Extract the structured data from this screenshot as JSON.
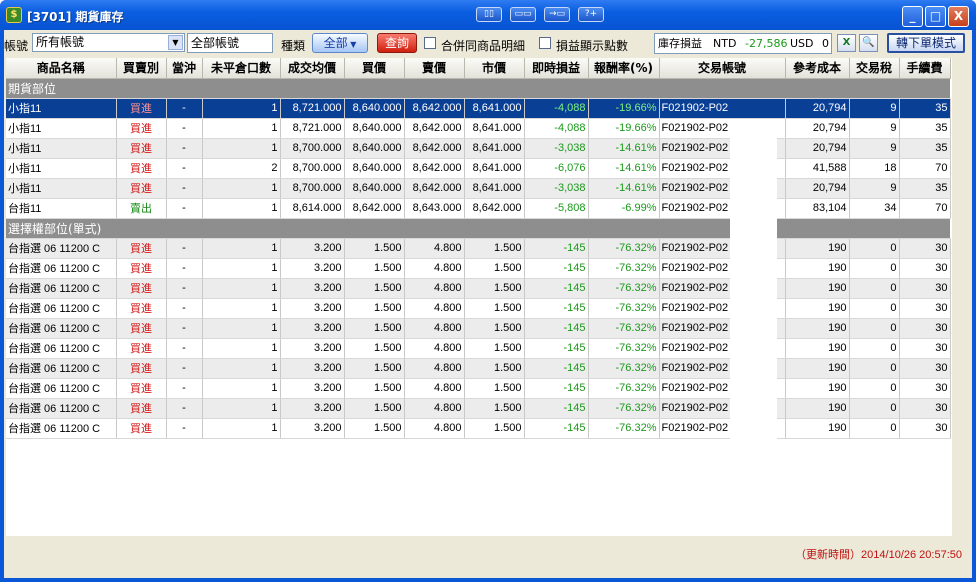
{
  "window": {
    "title": "[3701] 期貨庫存",
    "title_icon": "app-icon",
    "mid_buttons": [
      "▯▯",
      "▭▭",
      "→▭",
      "?+"
    ],
    "minimize": "_",
    "maximize": "□",
    "close": "X"
  },
  "toolbar": {
    "account_label": "帳號",
    "account_select": "所有帳號",
    "account_name": "全部帳號",
    "kind_label": "種類",
    "kind_button": "全部",
    "query_button": "查詢",
    "merge_label": "合併同商品明細",
    "points_label": "損益顯示點數",
    "pnl": {
      "label": "庫存損益",
      "ntd_label": "NTD",
      "ntd_value": "-27,586",
      "usd_label": "USD",
      "usd_value": "0"
    },
    "switch_button": "轉下單模式"
  },
  "columns": [
    "商品名稱",
    "買賣別",
    "當沖",
    "未平倉口數",
    "成交均價",
    "買價",
    "賣價",
    "市價",
    "即時損益",
    "報酬率(%)",
    "交易帳號",
    "參考成本",
    "交易稅",
    "手續費"
  ],
  "futures_section": "期貨部位",
  "futures_rows": [
    {
      "name": "小指11",
      "side": "買進",
      "dt": "-",
      "qty": "1",
      "avg": "8,721.000",
      "bid": "8,640.000",
      "ask": "8,642.000",
      "mkt": "8,641.000",
      "pnl": "-4,088",
      "ret": "-19.66%",
      "acct": "F021902-P02",
      "cost": "20,794",
      "tax": "9",
      "fee": "35"
    },
    {
      "name": "小指11",
      "side": "買進",
      "dt": "-",
      "qty": "1",
      "avg": "8,721.000",
      "bid": "8,640.000",
      "ask": "8,642.000",
      "mkt": "8,641.000",
      "pnl": "-4,088",
      "ret": "-19.66%",
      "acct": "F021902-P02",
      "cost": "20,794",
      "tax": "9",
      "fee": "35"
    },
    {
      "name": "小指11",
      "side": "買進",
      "dt": "-",
      "qty": "1",
      "avg": "8,700.000",
      "bid": "8,640.000",
      "ask": "8,642.000",
      "mkt": "8,641.000",
      "pnl": "-3,038",
      "ret": "-14.61%",
      "acct": "F021902-P02",
      "cost": "20,794",
      "tax": "9",
      "fee": "35"
    },
    {
      "name": "小指11",
      "side": "買進",
      "dt": "-",
      "qty": "2",
      "avg": "8,700.000",
      "bid": "8,640.000",
      "ask": "8,642.000",
      "mkt": "8,641.000",
      "pnl": "-6,076",
      "ret": "-14.61%",
      "acct": "F021902-P02",
      "cost": "41,588",
      "tax": "18",
      "fee": "70"
    },
    {
      "name": "小指11",
      "side": "買進",
      "dt": "-",
      "qty": "1",
      "avg": "8,700.000",
      "bid": "8,640.000",
      "ask": "8,642.000",
      "mkt": "8,641.000",
      "pnl": "-3,038",
      "ret": "-14.61%",
      "acct": "F021902-P02",
      "cost": "20,794",
      "tax": "9",
      "fee": "35"
    },
    {
      "name": "台指11",
      "side": "賣出",
      "dt": "-",
      "qty": "1",
      "avg": "8,614.000",
      "bid": "8,642.000",
      "ask": "8,643.000",
      "mkt": "8,642.000",
      "pnl": "-5,808",
      "ret": "-6.99%",
      "acct": "F021902-P02",
      "cost": "83,104",
      "tax": "34",
      "fee": "70"
    }
  ],
  "options_section": "選擇權部位(單式)",
  "options_rows": [
    {
      "name": "台指選 06 11200 C",
      "side": "買進",
      "dt": "-",
      "qty": "1",
      "avg": "3.200",
      "bid": "1.500",
      "ask": "4.800",
      "mkt": "1.500",
      "pnl": "-145",
      "ret": "-76.32%",
      "acct": "F021902-P02",
      "cost": "190",
      "tax": "0",
      "fee": "30"
    },
    {
      "name": "台指選 06 11200 C",
      "side": "買進",
      "dt": "-",
      "qty": "1",
      "avg": "3.200",
      "bid": "1.500",
      "ask": "4.800",
      "mkt": "1.500",
      "pnl": "-145",
      "ret": "-76.32%",
      "acct": "F021902-P02",
      "cost": "190",
      "tax": "0",
      "fee": "30"
    },
    {
      "name": "台指選 06 11200 C",
      "side": "買進",
      "dt": "-",
      "qty": "1",
      "avg": "3.200",
      "bid": "1.500",
      "ask": "4.800",
      "mkt": "1.500",
      "pnl": "-145",
      "ret": "-76.32%",
      "acct": "F021902-P02",
      "cost": "190",
      "tax": "0",
      "fee": "30"
    },
    {
      "name": "台指選 06 11200 C",
      "side": "買進",
      "dt": "-",
      "qty": "1",
      "avg": "3.200",
      "bid": "1.500",
      "ask": "4.800",
      "mkt": "1.500",
      "pnl": "-145",
      "ret": "-76.32%",
      "acct": "F021902-P02",
      "cost": "190",
      "tax": "0",
      "fee": "30"
    },
    {
      "name": "台指選 06 11200 C",
      "side": "買進",
      "dt": "-",
      "qty": "1",
      "avg": "3.200",
      "bid": "1.500",
      "ask": "4.800",
      "mkt": "1.500",
      "pnl": "-145",
      "ret": "-76.32%",
      "acct": "F021902-P02",
      "cost": "190",
      "tax": "0",
      "fee": "30"
    },
    {
      "name": "台指選 06 11200 C",
      "side": "買進",
      "dt": "-",
      "qty": "1",
      "avg": "3.200",
      "bid": "1.500",
      "ask": "4.800",
      "mkt": "1.500",
      "pnl": "-145",
      "ret": "-76.32%",
      "acct": "F021902-P02",
      "cost": "190",
      "tax": "0",
      "fee": "30"
    },
    {
      "name": "台指選 06 11200 C",
      "side": "買進",
      "dt": "-",
      "qty": "1",
      "avg": "3.200",
      "bid": "1.500",
      "ask": "4.800",
      "mkt": "1.500",
      "pnl": "-145",
      "ret": "-76.32%",
      "acct": "F021902-P02",
      "cost": "190",
      "tax": "0",
      "fee": "30"
    },
    {
      "name": "台指選 06 11200 C",
      "side": "買進",
      "dt": "-",
      "qty": "1",
      "avg": "3.200",
      "bid": "1.500",
      "ask": "4.800",
      "mkt": "1.500",
      "pnl": "-145",
      "ret": "-76.32%",
      "acct": "F021902-P02",
      "cost": "190",
      "tax": "0",
      "fee": "30"
    },
    {
      "name": "台指選 06 11200 C",
      "side": "買進",
      "dt": "-",
      "qty": "1",
      "avg": "3.200",
      "bid": "1.500",
      "ask": "4.800",
      "mkt": "1.500",
      "pnl": "-145",
      "ret": "-76.32%",
      "acct": "F021902-P02",
      "cost": "190",
      "tax": "0",
      "fee": "30"
    },
    {
      "name": "台指選 06 11200 C",
      "side": "買進",
      "dt": "-",
      "qty": "1",
      "avg": "3.200",
      "bid": "1.500",
      "ask": "4.800",
      "mkt": "1.500",
      "pnl": "-145",
      "ret": "-76.32%",
      "acct": "F021902-P02",
      "cost": "190",
      "tax": "0",
      "fee": "30"
    }
  ],
  "status": {
    "update_time": "（更新時間）2014/10/26 20:57:50"
  }
}
